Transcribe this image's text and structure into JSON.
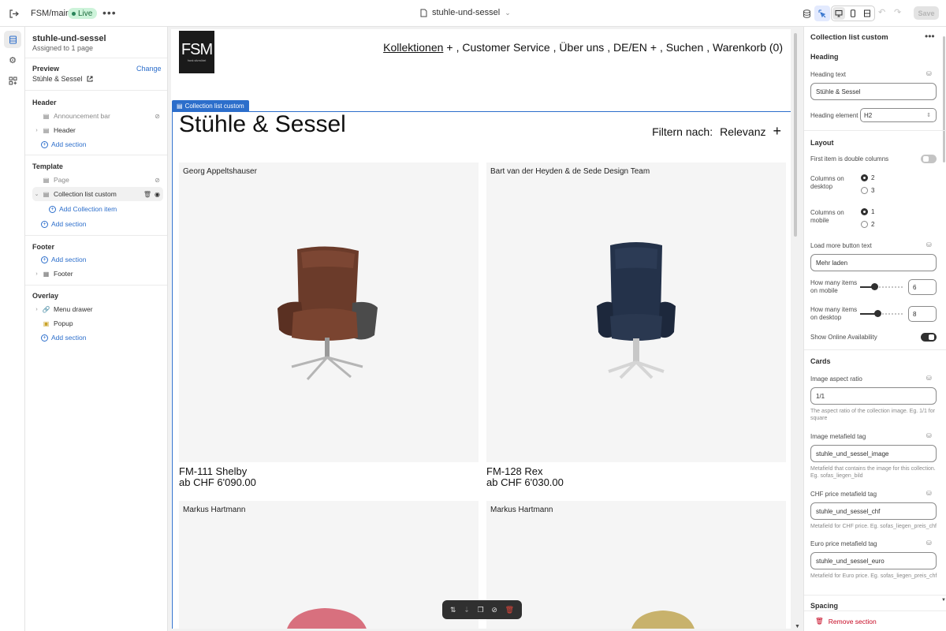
{
  "topbar": {
    "store": "FSM/main",
    "live": "Live",
    "page": "stuhle-und-sessel",
    "save": "Save"
  },
  "left": {
    "title": "stuhle-und-sessel",
    "assigned": "Assigned to 1 page",
    "preview_h": "Preview",
    "change": "Change",
    "preview_value": "Stühle & Sessel",
    "header_h": "Header",
    "announcement": "Announcement bar",
    "header_item": "Header",
    "add_section": "Add section",
    "template_h": "Template",
    "page_item": "Page",
    "collection_item": "Collection list custom",
    "add_collection_item": "Add Collection item",
    "footer_h": "Footer",
    "footer_item": "Footer",
    "overlay_h": "Overlay",
    "menu_drawer": "Menu drawer",
    "popup": "Popup"
  },
  "site": {
    "logo": "FSM",
    "logo_small": "frank sitzmöbel",
    "nav": {
      "kollektionen": "Kollektionen",
      "customer": ", Customer Service",
      "ueber": ", Über uns",
      "lang": ", DE/EN",
      "suchen": ", Suchen",
      "warenkorb": ", Warenkorb (0)"
    },
    "section_tag": "Collection list custom",
    "heading": "Stühle & Sessel",
    "filter_label": "Filtern nach:",
    "filter_value": "Relevanz",
    "cards": [
      {
        "designer": "Georg Appeltshauser",
        "name": "FM-111 Shelby",
        "price": "ab CHF 6'090.00"
      },
      {
        "designer": "Bart van der Heyden & de Sede Design Team",
        "name": "FM-128 Rex",
        "price": "ab CHF 6'030.00"
      },
      {
        "designer": "Markus Hartmann"
      },
      {
        "designer": "Markus Hartmann"
      }
    ]
  },
  "right": {
    "title": "Collection list custom",
    "heading_h": "Heading",
    "heading_text_lbl": "Heading text",
    "heading_text_val": "Stühle & Sessel",
    "heading_el_lbl": "Heading element",
    "heading_el_val": "H2",
    "layout_h": "Layout",
    "double_lbl": "First item is double columns",
    "cols_desktop_lbl": "Columns on desktop",
    "cols_desktop_opts": [
      "2",
      "3"
    ],
    "cols_mobile_lbl": "Columns on mobile",
    "cols_mobile_opts": [
      "1",
      "2"
    ],
    "load_more_lbl": "Load more button text",
    "load_more_val": "Mehr laden",
    "items_mobile_lbl": "How many items on mobile",
    "items_mobile_val": "6",
    "items_desktop_lbl": "How many items on desktop",
    "items_desktop_val": "8",
    "online_lbl": "Show Online Availability",
    "cards_h": "Cards",
    "aspect_lbl": "Image aspect ratio",
    "aspect_val": "1/1",
    "aspect_help": "The aspect ratio of the collection image. Eg. 1/1 for square",
    "meta_lbl": "Image metafield tag",
    "meta_val": "stuhle_und_sessel_image",
    "meta_help": "Metafield that contains the image for this collection. Eg. sofas_liegen_bild",
    "chf_lbl": "CHF price metafield tag",
    "chf_val": "stuhle_und_sessel_chf",
    "chf_help": "Metafield for CHF price. Eg. sofas_liegen_preis_chf",
    "euro_lbl": "Euro price metafield tag",
    "euro_val": "stuhle_und_sessel_euro",
    "euro_help": "Metafield for Euro price. Eg. sofas_liegen_preis_chf",
    "spacing_h": "Spacing",
    "remove": "Remove section"
  },
  "sliders": {
    "items_mobile_fraction": 0.33,
    "items_desktop_fraction": 0.4
  },
  "colors": {
    "accent": "#2c6ecb",
    "live_bg": "#cdf3da",
    "danger": "#c70a24",
    "chair1": "#6b3b2a",
    "chair2": "#24324a"
  }
}
